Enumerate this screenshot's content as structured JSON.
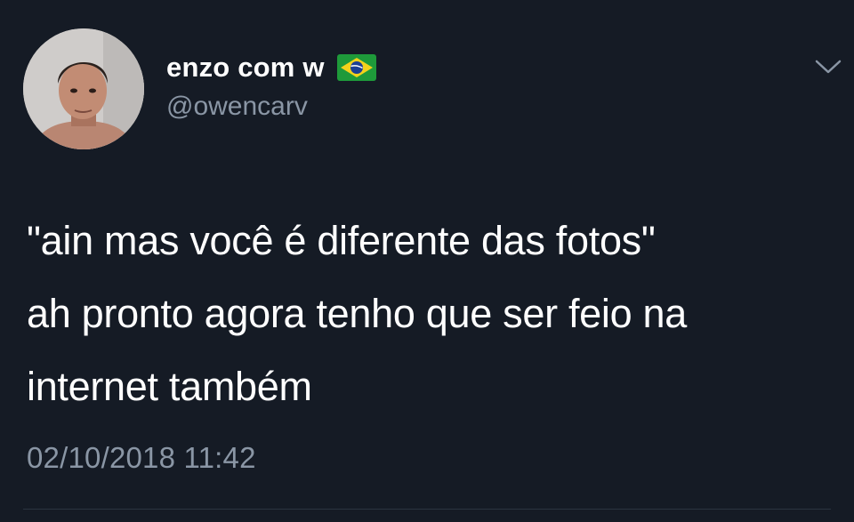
{
  "tweet": {
    "author": {
      "display_name": "enzo com w",
      "flag_icon": "brazil-flag-icon",
      "handle": "@owencarv"
    },
    "text_lines": [
      "\"ain mas você é diferente das fotos\"",
      "ah pronto agora tenho que ser feio na",
      "internet também"
    ],
    "timestamp": "02/10/2018 11:42",
    "menu_icon": "chevron-down-icon"
  },
  "colors": {
    "background": "#151b25",
    "text_primary": "#ffffff",
    "text_secondary": "#8a96a5",
    "divider": "#2b3440"
  }
}
